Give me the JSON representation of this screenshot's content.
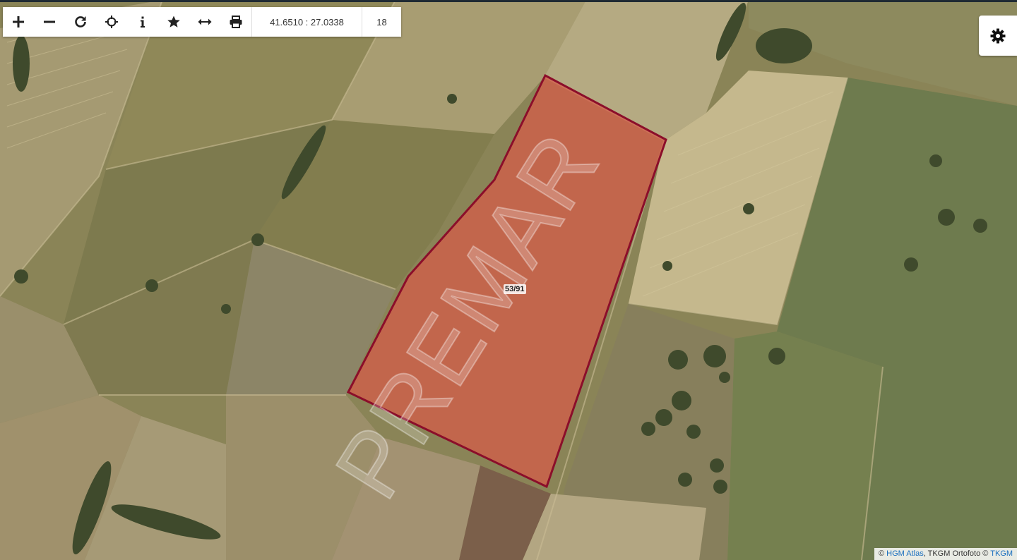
{
  "toolbar": {
    "tools": [
      {
        "name": "zoom-in",
        "icon": "plus-icon"
      },
      {
        "name": "zoom-out",
        "icon": "minus-icon"
      },
      {
        "name": "refresh",
        "icon": "refresh-icon"
      },
      {
        "name": "locate",
        "icon": "crosshair-icon"
      },
      {
        "name": "info",
        "icon": "info-icon"
      },
      {
        "name": "favorite",
        "icon": "star-icon"
      },
      {
        "name": "measure",
        "icon": "arrows-horizontal-icon"
      },
      {
        "name": "print",
        "icon": "printer-icon"
      }
    ],
    "coordinates": "41.6510 : 27.0338",
    "zoom_level": "18"
  },
  "settings": {
    "icon": "gear-icon"
  },
  "parcel": {
    "label": "53/91",
    "fill_color": "#d85a48",
    "border_color": "#8b0e2a"
  },
  "watermark": {
    "text": "PREMAR"
  },
  "attribution": {
    "copyright_1": "©",
    "link_1": "HGM Atlas",
    "mid_text": ", TKGM Ortofoto ©",
    "link_2": "TKGM"
  }
}
